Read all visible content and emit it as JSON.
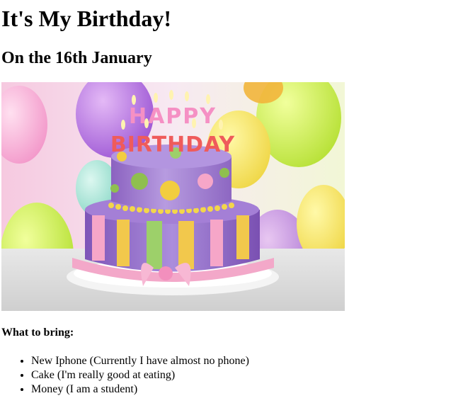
{
  "heading": "It's My Birthday!",
  "subheading": "On the 16th January",
  "image": {
    "description": "birthday-cake-photo",
    "candle_text": "HAPPY BIRTHDAY"
  },
  "bring_heading": "What to bring:",
  "bring_items": [
    "New Iphone (Currently I have almost no phone)",
    "Cake (I'm really good at eating)",
    "Money (I am a student)"
  ]
}
